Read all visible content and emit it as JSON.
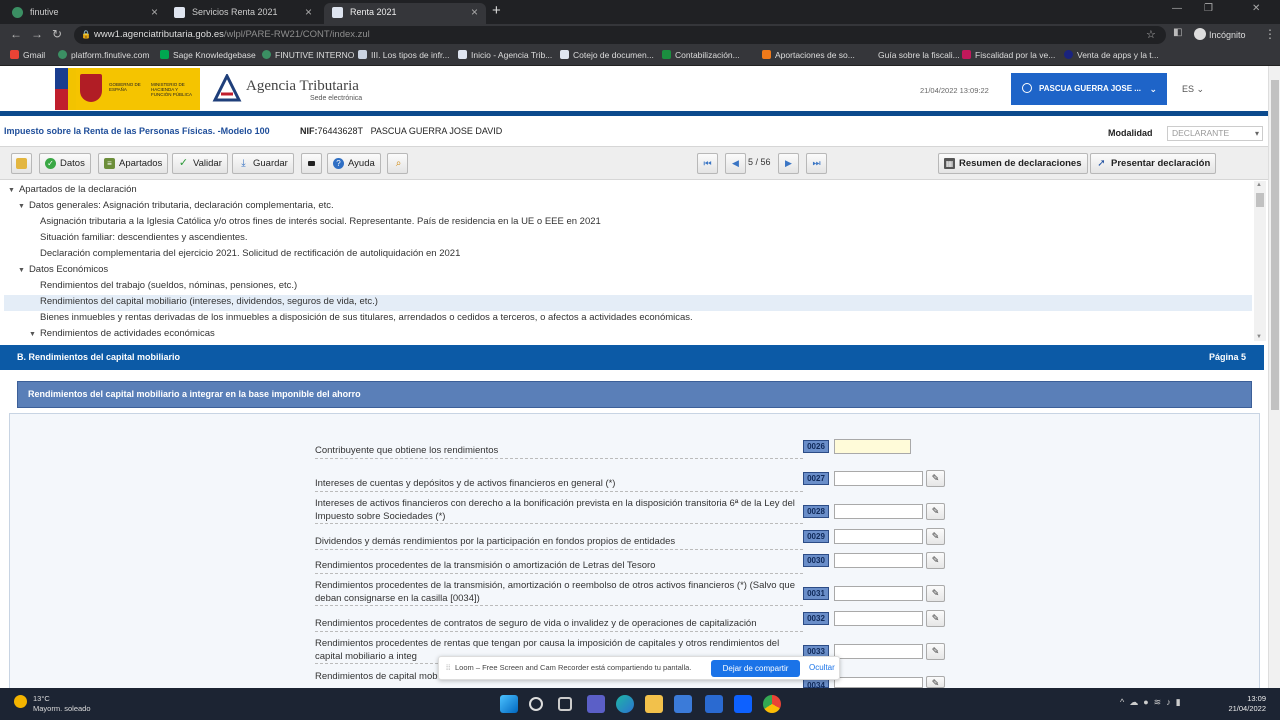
{
  "browser": {
    "tabs": [
      {
        "label": "finutive",
        "active": false
      },
      {
        "label": "Servicios Renta 2021",
        "active": false
      },
      {
        "label": "Renta 2021",
        "active": true
      }
    ],
    "url_host": "www1.agenciatributaria.gob.es",
    "url_path": "/wlpl/PARE-RW21/CONT/index.zul",
    "profile": "Incógnito",
    "bookmarks": [
      "Gmail",
      "platform.finutive.com",
      "Sage Knowledgebase",
      "FINUTIVE INTERNO",
      "III. Los tipos de infr...",
      "Inicio - Agencia Trib...",
      "Cotejo de documen...",
      "Contabilización...",
      "Aportaciones de so...",
      "Guía sobre la fiscali...",
      "Fiscalidad por la ve...",
      "Venta de apps y la t..."
    ]
  },
  "header": {
    "gob_line1": "GOBIERNO DE ESPAÑA",
    "gob_line2": "MINISTERIO DE HACIENDA Y FUNCIÓN PÚBLICA",
    "agency": "Agencia Tributaria",
    "agency_sub": "Sede electrónica",
    "datetime": "21/04/2022 13:09:22",
    "user": "PASCUA GUERRA JOSE ...",
    "lang": "ES"
  },
  "model": {
    "title": "Impuesto sobre la Renta de las Personas Físicas. -Modelo 100",
    "nif_label": "NIF:",
    "nif_value": "76443628T",
    "taxpayer": "PASCUA GUERRA JOSE DAVID",
    "modalidad_label": "Modalidad",
    "modalidad_value": "DECLARANTE"
  },
  "toolbar": {
    "datos": "Datos",
    "apartados": "Apartados",
    "validar": "Validar",
    "guardar": "Guardar",
    "ayuda": "Ayuda",
    "page": "5 / 56",
    "resumen": "Resumen de declaraciones",
    "presentar": "Presentar declaración"
  },
  "tree": [
    {
      "label": "Apartados de la declaración",
      "level": 0,
      "expanded": true
    },
    {
      "label": "Datos generales: Asignación tributaria, declaración complementaria, etc.",
      "level": 1,
      "expanded": true
    },
    {
      "label": "Asignación tributaria a la Iglesia Católica y/o otros fines de interés social. Representante. País de residencia en la UE o EEE en 2021",
      "level": 2
    },
    {
      "label": "Situación familiar: descendientes y ascendientes.",
      "level": 2
    },
    {
      "label": "Declaración complementaria del ejercicio 2021. Solicitud de rectificación de autoliquidación en 2021",
      "level": 2
    },
    {
      "label": "Datos Económicos",
      "level": 1,
      "expanded": true
    },
    {
      "label": "Rendimientos del trabajo (sueldos, nóminas, pensiones, etc.)",
      "level": 2
    },
    {
      "label": "Rendimientos del capital mobiliario (intereses, dividendos, seguros de vida, etc.)",
      "level": 2,
      "selected": true
    },
    {
      "label": "Bienes inmuebles y rentas derivadas de los inmuebles a disposición de sus titulares, arrendados o cedidos a terceros, o afectos a actividades económicas.",
      "level": 2
    },
    {
      "label": "Rendimientos de actividades económicas",
      "level": 2,
      "expanded": true
    }
  ],
  "section": {
    "title": "B.  Rendimientos del capital mobiliario",
    "page": "Página 5",
    "subtitle": "Rendimientos del capital mobiliario a integrar en la base imponible del ahorro"
  },
  "fields": [
    {
      "label": "Contribuyente que obtiene los rendimientos",
      "code": "0026"
    },
    {
      "label": "Intereses de cuentas y depósitos y de activos financieros en general (*)",
      "code": "0027"
    },
    {
      "label": "Intereses de activos financieros con derecho a la bonificación prevista en la disposición transitoria 6ª de la Ley del Impuesto sobre Sociedades (*)",
      "code": "0028"
    },
    {
      "label": "Dividendos y demás rendimientos por la participación en fondos propios de entidades",
      "code": "0029"
    },
    {
      "label": "Rendimientos procedentes de la transmisión o amortización de Letras del Tesoro",
      "code": "0030"
    },
    {
      "label": "Rendimientos procedentes de la transmisión, amortización o reembolso de otros activos financieros (*) (Salvo que deban consignarse en la casilla [0034])",
      "code": "0031"
    },
    {
      "label": "Rendimientos procedentes de contratos de seguro de vida o invalidez y de operaciones de capitalización",
      "code": "0032"
    },
    {
      "label": "Rendimientos procedentes de rentas que tengan por causa la imposición de capitales y otros rendimientos del capital mobiliario a integ",
      "code": "0033"
    },
    {
      "label": "Rendimientos de capital mob",
      "code": "0034"
    }
  ],
  "loom": {
    "message": "Loom – Free Screen and Cam Recorder está compartiendo tu pantalla.",
    "stop": "Dejar de compartir",
    "hide": "Ocultar"
  },
  "taskbar": {
    "temp": "13°C",
    "weather": "Mayorm. soleado",
    "time": "13:09",
    "date": "21/04/2022"
  }
}
